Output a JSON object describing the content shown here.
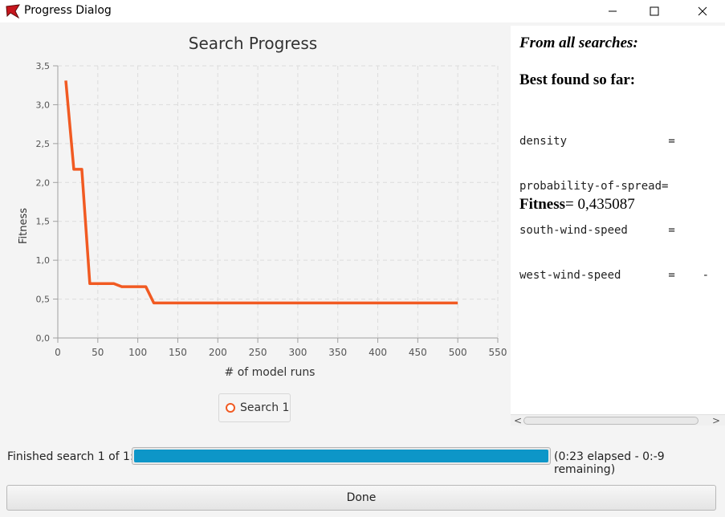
{
  "window": {
    "title": "Progress Dialog",
    "icon": "netlogo-turtle-icon",
    "controls": [
      "minimize",
      "maximize",
      "close"
    ]
  },
  "chart_data": {
    "type": "line",
    "title": "Search Progress",
    "xlabel": "# of model runs",
    "ylabel": "Fitness",
    "xlim": [
      0,
      550
    ],
    "ylim": [
      0,
      3.5
    ],
    "x_ticks": [
      "0",
      "50",
      "100",
      "150",
      "200",
      "250",
      "300",
      "350",
      "400",
      "450",
      "500",
      "550"
    ],
    "y_ticks": [
      "0,0",
      "0,5",
      "1,0",
      "1,5",
      "2,0",
      "2,5",
      "3,0",
      "3,5"
    ],
    "grid": true,
    "legend_position": "bottom-center",
    "series": [
      {
        "name": "Search 1",
        "color": "#f15a22",
        "x": [
          10,
          20,
          30,
          40,
          50,
          60,
          70,
          80,
          90,
          100,
          110,
          120,
          130,
          500
        ],
        "y": [
          3.31,
          2.17,
          2.17,
          0.7,
          0.7,
          0.7,
          0.7,
          0.66,
          0.66,
          0.66,
          0.66,
          0.45,
          0.45,
          0.45
        ]
      }
    ]
  },
  "info": {
    "heading_all": "From all searches:",
    "heading_best": "Best found so far:",
    "params": [
      "density               =",
      "probability-of-spread=",
      "south-wind-speed      =",
      "west-wind-speed       =    -"
    ],
    "fitness_label": "Fitness",
    "fitness_value": "= 0,435087"
  },
  "status": {
    "label": "Finished search 1 of 1:",
    "progress_fraction": 1.0,
    "elapsed": "(0:23 elapsed - 0:-9 remaining)"
  },
  "done_label": "Done",
  "scrollbar": {
    "left_arrow": "<",
    "right_arrow": ">"
  }
}
